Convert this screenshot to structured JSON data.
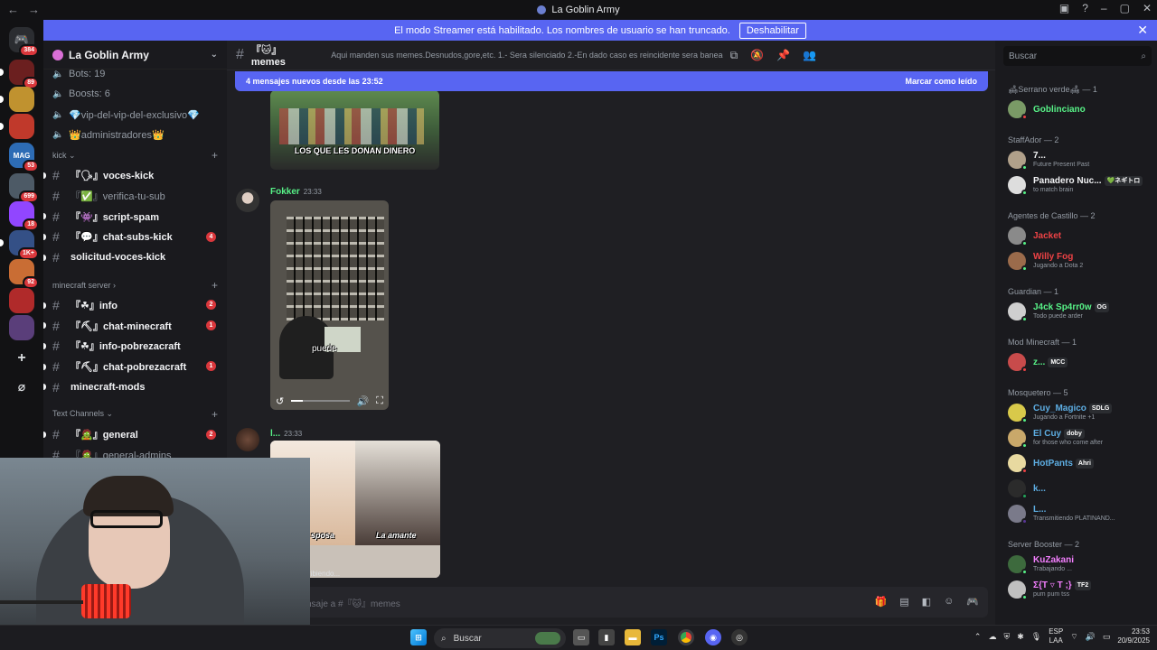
{
  "window": {
    "title": "La Goblin Army"
  },
  "banner": {
    "text": "El modo Streamer está habilitado. Los nombres de usuario se han truncado.",
    "button": "Deshabilitar"
  },
  "servers": [
    {
      "badge": "384",
      "label": "DC"
    },
    {
      "badge": "89",
      "label": ""
    },
    {
      "badge": "",
      "label": ""
    },
    {
      "badge": "",
      "label": ""
    },
    {
      "badge": "53",
      "label": "MAG"
    },
    {
      "badge": "699",
      "label": ""
    },
    {
      "badge": "18",
      "label": ""
    },
    {
      "badge": "1K+",
      "label": ""
    },
    {
      "badge": "92",
      "label": ""
    },
    {
      "badge": "",
      "label": ""
    },
    {
      "badge": "",
      "label": ""
    }
  ],
  "guild": {
    "name": "La Goblin Army"
  },
  "sidebar": {
    "top_items": [
      "Bots: 19",
      "Boosts: 6",
      "💎vip-del-vip-del-exclusivo💎",
      "👑administradores👑"
    ],
    "categories": [
      {
        "name": "kick",
        "channels": [
          {
            "name": "『🗣』voces-kick",
            "unread": true,
            "count": ""
          },
          {
            "name": "『✅』verifica-tu-sub",
            "unread": false,
            "count": ""
          },
          {
            "name": "『👾』script-spam",
            "unread": true,
            "count": ""
          },
          {
            "name": "『💬』chat-subs-kick",
            "unread": true,
            "count": "4"
          },
          {
            "name": "solicitud-voces-kick",
            "unread": true,
            "count": ""
          }
        ]
      },
      {
        "name": "minecraft server",
        "channels": [
          {
            "name": "『☘』info",
            "unread": true,
            "count": "2"
          },
          {
            "name": "『⛏』chat-minecraft",
            "unread": true,
            "count": "1"
          },
          {
            "name": "『☘』info-pobrezacraft",
            "unread": true,
            "count": ""
          },
          {
            "name": "『⛏』chat-pobrezacraft",
            "unread": true,
            "count": "1"
          },
          {
            "name": "minecraft-mods",
            "unread": true,
            "count": ""
          }
        ]
      },
      {
        "name": "Text Channels",
        "channels": [
          {
            "name": "『🧟』general",
            "unread": true,
            "count": "2"
          },
          {
            "name": "『🧟』general-admins",
            "unread": false,
            "count": ""
          }
        ]
      }
    ]
  },
  "channel": {
    "name": "『🐱』memes",
    "topic": "Aqui manden sus memes.Desnudos,gore,etc. 1.- Sera silenciado 2.-En dado caso es reincidente sera baneado"
  },
  "search": {
    "placeholder": "Buscar"
  },
  "newbar": {
    "text": "4 mensajes nuevos desde las 23:52",
    "action": "Marcar como leído"
  },
  "messages": [
    {
      "author": "",
      "time": "",
      "caption": "LOS QUE LES DONAN DINERO"
    },
    {
      "author": "Fokker",
      "time": "23:33",
      "caption": "puede"
    },
    {
      "author": "l...",
      "time": "23:33",
      "caption": "sposa",
      "caption2": "La amante"
    }
  ],
  "typing": "ribiendo...",
  "composer": {
    "placeholder": "nsaje a #『🐱』memes"
  },
  "members": {
    "groups": [
      {
        "header": "🛋Serrano verde🛋 — 1",
        "members": [
          {
            "name": "Goblinciano",
            "sub": "",
            "tag": "",
            "color": "#57f287"
          }
        ]
      },
      {
        "header": "StaffAdor — 2",
        "members": [
          {
            "name": "7...",
            "sub": "Future Present Past",
            "tag": "",
            "color": "#f2f3f5"
          },
          {
            "name": "Panadero Nuc...",
            "sub": "to match brain",
            "tag": "💚ネギトロ",
            "color": "#f2f3f5"
          }
        ]
      },
      {
        "header": "Agentes de Castillo — 2",
        "members": [
          {
            "name": "Jacket",
            "sub": "",
            "tag": "",
            "color": "#ed4245"
          },
          {
            "name": "Willy Fog",
            "sub": "Jugando a Dota 2",
            "tag": "",
            "color": "#ed4245"
          }
        ]
      },
      {
        "header": "Guardian — 1",
        "members": [
          {
            "name": "J4ck Sp4rr0w",
            "sub": "Todo puede arder",
            "tag": "OG",
            "color": "#57f287"
          }
        ]
      },
      {
        "header": "Mod Minecraft — 1",
        "members": [
          {
            "name": "z...",
            "sub": "",
            "tag": "MCC",
            "color": "#57f287"
          }
        ]
      },
      {
        "header": "Mosquetero — 5",
        "members": [
          {
            "name": "Cuy_Magico",
            "sub": "Jugando a Fortnite +1",
            "tag": "SDLG",
            "color": "#5dade2"
          },
          {
            "name": "El Cuy",
            "sub": "for those who come after",
            "tag": "doby",
            "color": "#5dade2"
          },
          {
            "name": "HotPants",
            "sub": "",
            "tag": "Ahri",
            "color": "#5dade2"
          },
          {
            "name": "k...",
            "sub": "",
            "tag": "",
            "color": "#5dade2"
          },
          {
            "name": "L...",
            "sub": "Transmitiendo PLATINAND...",
            "tag": "",
            "color": "#5dade2"
          }
        ]
      },
      {
        "header": "Server Booster — 2",
        "members": [
          {
            "name": "KuZakani",
            "sub": "Trabajando ...",
            "tag": "",
            "color": "#f47fff"
          },
          {
            "name": "Σ{T ▿ T ;}",
            "sub": "pum pum tss",
            "tag": "TF2",
            "color": "#f47fff"
          }
        ]
      }
    ]
  },
  "taskbar": {
    "search": "Buscar",
    "lang": "ESP",
    "lang2": "LAA",
    "time": "23:53",
    "date": "20/9/2025"
  }
}
